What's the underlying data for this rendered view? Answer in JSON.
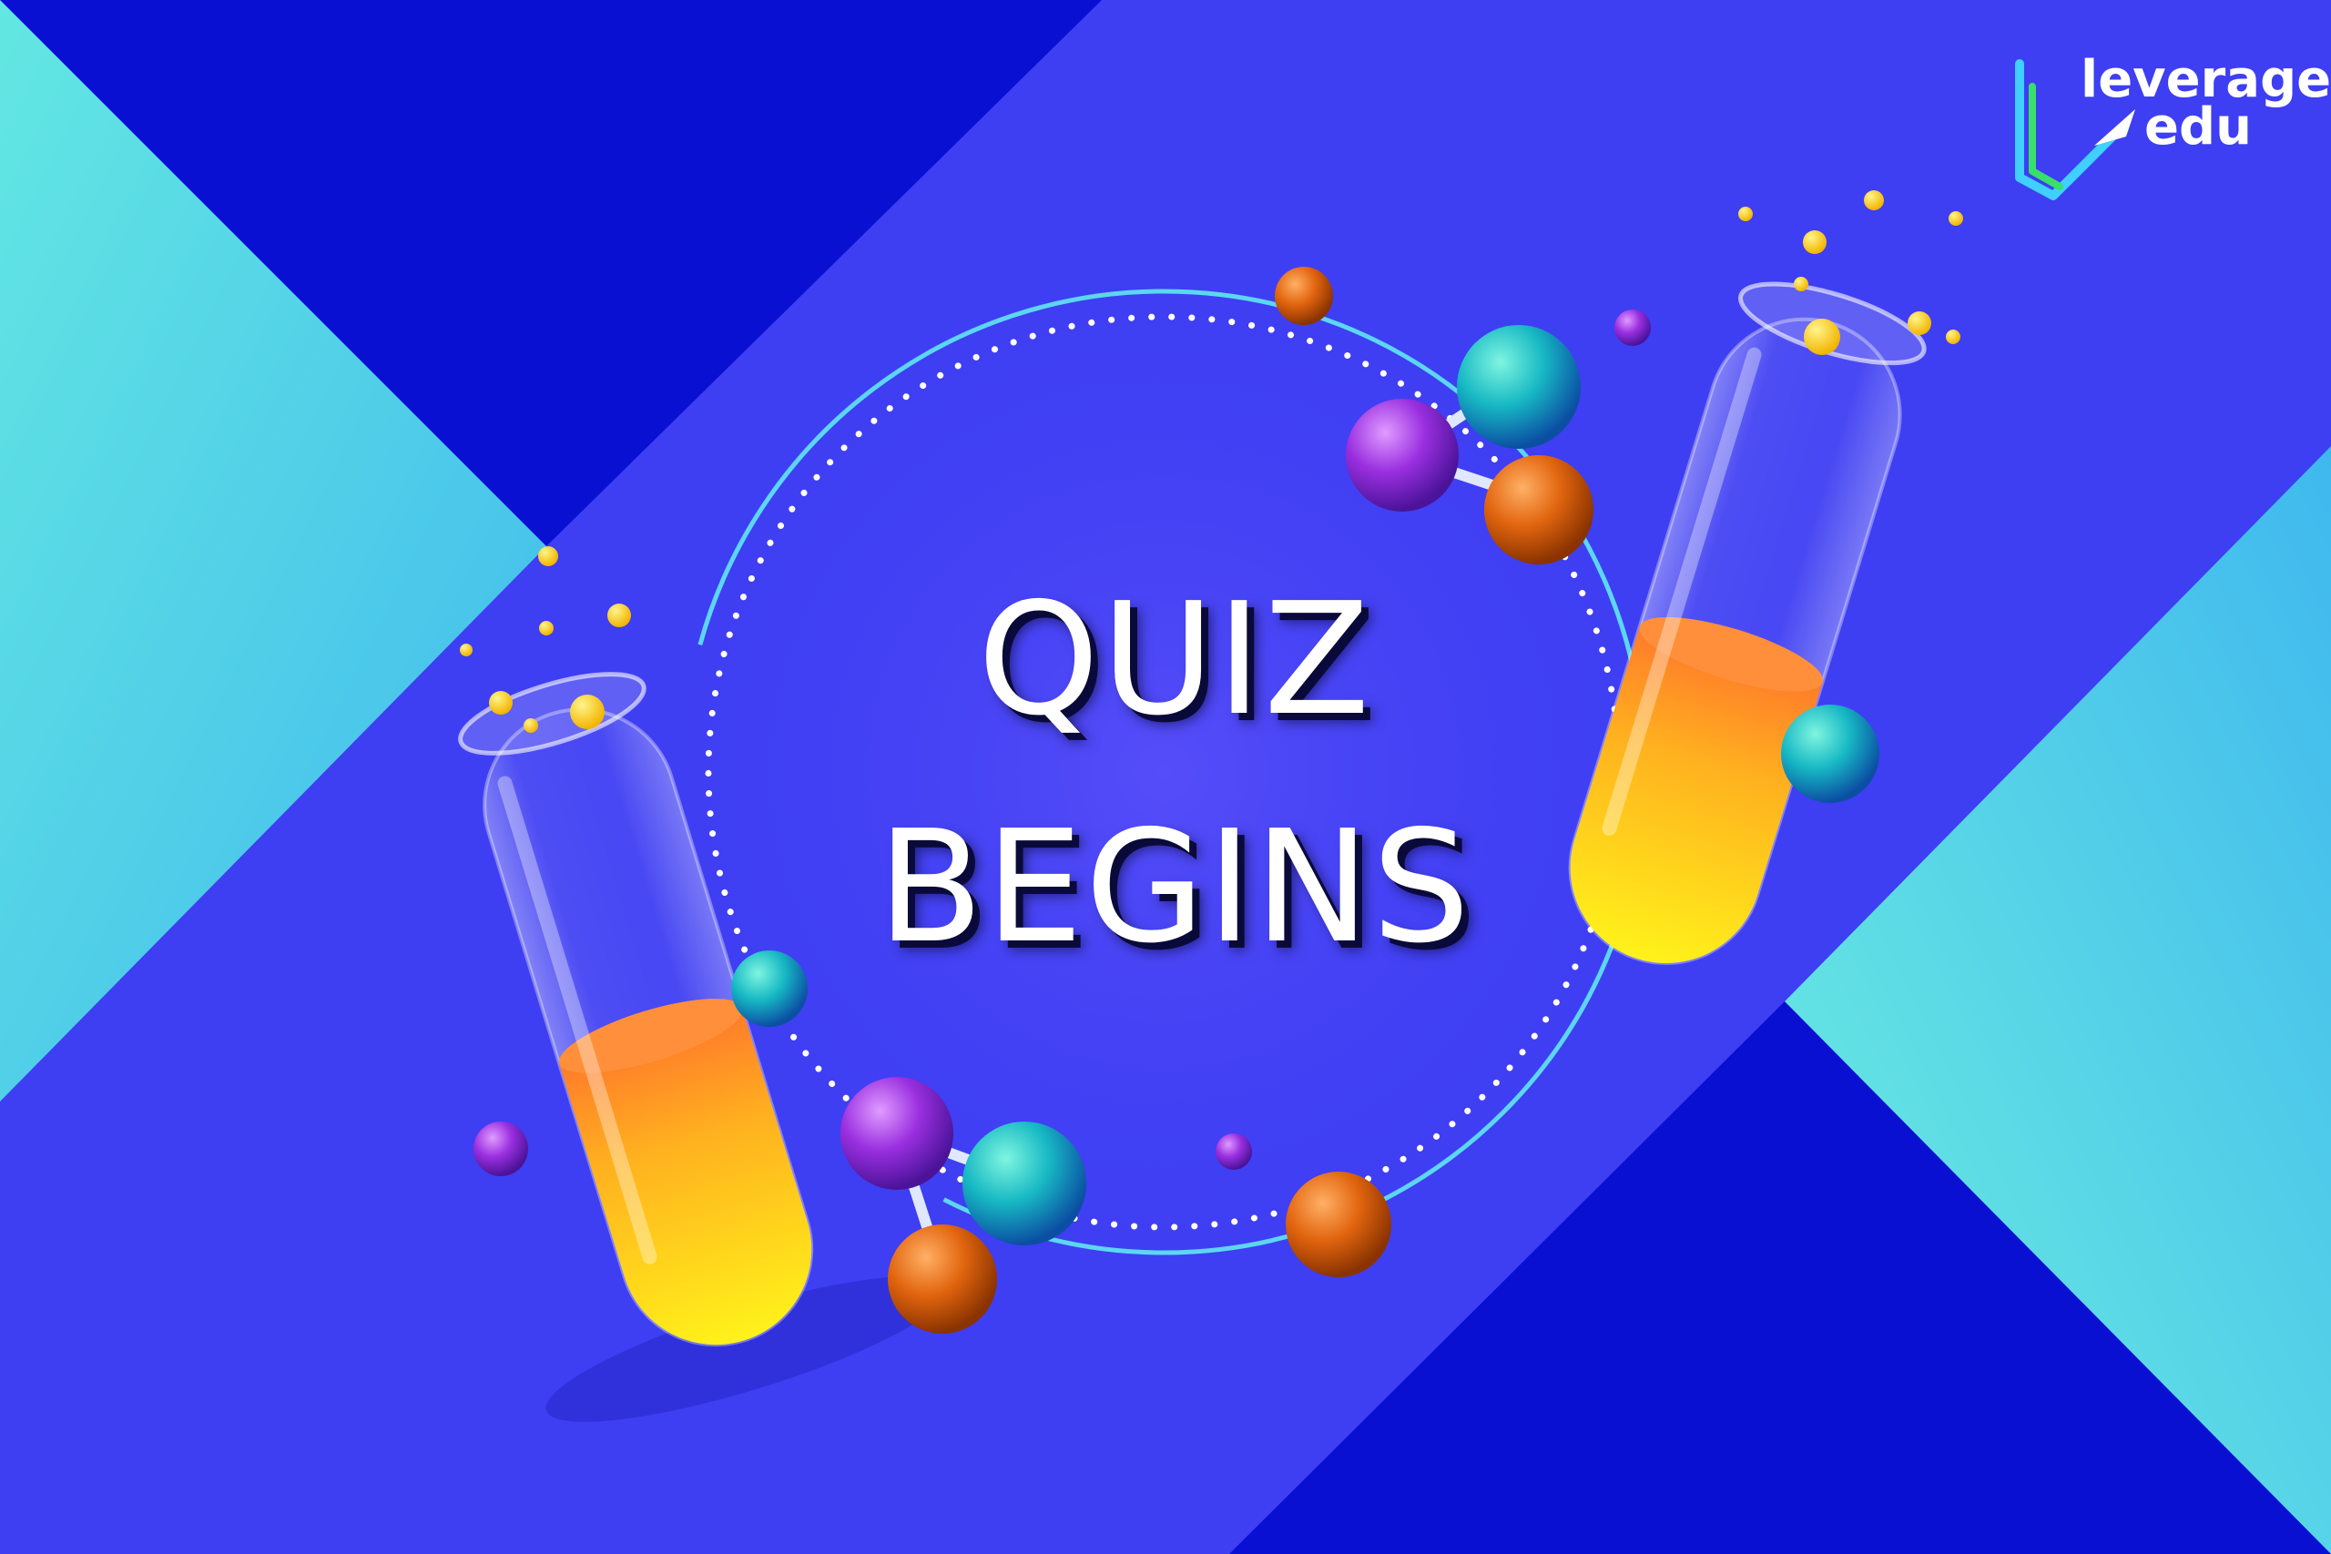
{
  "poster": {
    "title_line1": "QUIZ",
    "title_line2": "BEGINS"
  },
  "logo": {
    "line1": "leverage",
    "line2": "edu"
  },
  "colors": {
    "background": "#3e3ef3",
    "deep_blue": "#0a0fd0",
    "cyan": "#5ee0e6",
    "liquid_top": "#ff8a2a",
    "liquid_bottom": "#ffe21c",
    "ring": "#5cd6f2"
  }
}
